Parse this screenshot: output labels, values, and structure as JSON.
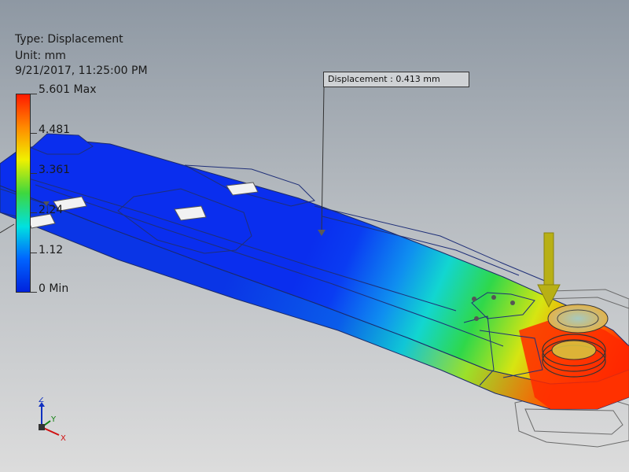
{
  "legend": {
    "type_line": "Type: Displacement",
    "unit_line": "Unit: mm",
    "date_line": "9/21/2017, 11:25:00 PM",
    "ticks": [
      "5.601 Max",
      "4.481",
      "3.361",
      "2.24",
      "1.12",
      "0 Min"
    ],
    "colors": [
      "#ff1a00",
      "#ff8c00",
      "#f0f000",
      "#3ed73e",
      "#00e0e0",
      "#0066ff",
      "#0022dd"
    ]
  },
  "probe": {
    "label": "Displacement : 0.413 mm"
  },
  "triad": {
    "z": "Z",
    "y": "Y",
    "x": "X"
  },
  "palette": {
    "background_top": "#8e98a3",
    "background_bottom": "#dcdcdc",
    "load_arrow": "#b8b015"
  }
}
